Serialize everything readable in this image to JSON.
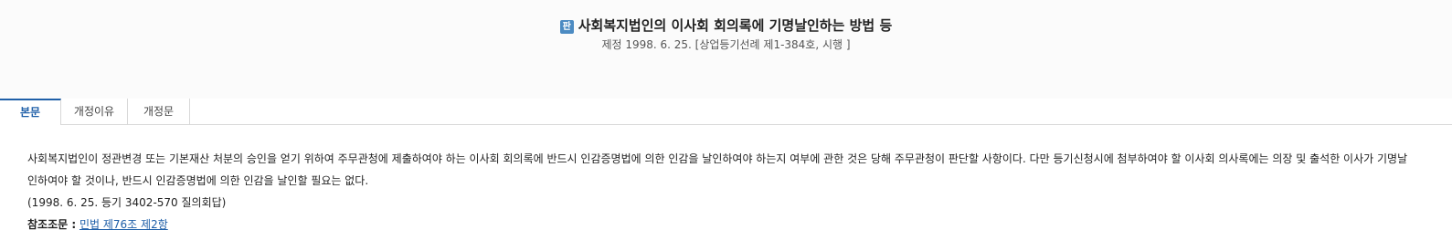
{
  "header": {
    "badge": "판",
    "title": "사회복지법인의 이사회 회의록에 기명날인하는 방법 등",
    "subtitle": "제정 1998. 6. 25. [상업등기선례 제1-384호, 시행 ]"
  },
  "tabs": [
    {
      "label": "본문",
      "active": true
    },
    {
      "label": "개정이유",
      "active": false
    },
    {
      "label": "개정문",
      "active": false
    }
  ],
  "body": {
    "paragraph": "사회복지법인이 정관변경 또는 기본재산 처분의 승인을 얻기 위하여 주무관청에 제출하여야 하는 이사회 회의록에 반드시 인감증명법에 의한 인감을 날인하여야 하는지 여부에 관한 것은 당해 주무관청이 판단할 사항이다. 다만 등기신청시에 첨부하여야 할 이사회 의사록에는 의장 및 출석한 이사가 기명날인하여야 할 것이나, 반드시 인감증명법에 의한 인감을 날인할 필요는 없다.",
    "source": "(1998. 6. 25. 등기 3402-570 질의회답)",
    "reference_label": "참조조문 :",
    "reference_link": "민법 제76조 제2항"
  }
}
